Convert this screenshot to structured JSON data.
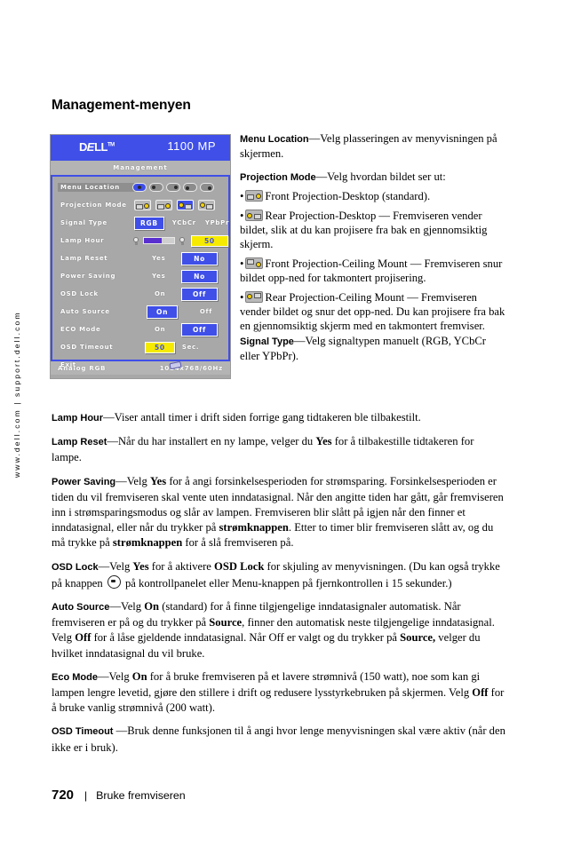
{
  "side_url": "www.dell.com | support.dell.com",
  "page_title": "Management-menyen",
  "osd": {
    "brand": "D",
    "brand_e": "E",
    "brand_rest": "LL",
    "tm": "TM",
    "model": "1100 MP",
    "tab_label": "Management",
    "rows": [
      {
        "label": "Menu Location",
        "type": "loc-icons",
        "selected_index": 0
      },
      {
        "label": "Projection Mode",
        "type": "pm-icons",
        "selected_index": 2
      },
      {
        "label": "Signal Type",
        "type": "options",
        "options": [
          "RGB",
          "YCbCr",
          "YPbPr"
        ],
        "selected_index": 0
      },
      {
        "label": "Lamp Hour",
        "type": "slider",
        "value": "50",
        "fill_percent": 60
      },
      {
        "label": "Lamp Reset",
        "type": "yesno",
        "left": "Yes",
        "right": "No",
        "selected": "right"
      },
      {
        "label": "Power Saving",
        "type": "yesno",
        "left": "Yes",
        "right": "No",
        "selected": "right"
      },
      {
        "label": "OSD Lock",
        "type": "onoff",
        "left": "On",
        "right": "Off",
        "selected": "right"
      },
      {
        "label": "Auto Source",
        "type": "onoff",
        "left": "On",
        "right": "Off",
        "selected": "left"
      },
      {
        "label": "ECO Mode",
        "type": "onoff",
        "left": "On",
        "right": "Off",
        "selected": "right"
      },
      {
        "label": "OSD Timeout",
        "type": "timeout",
        "value": "50",
        "unit": "Sec."
      },
      {
        "label": "Exit",
        "type": "exit"
      }
    ],
    "footer_left": "Analog RGB",
    "footer_right": "1024x768/60Hz"
  },
  "right_column": {
    "p1_term": "Menu Location",
    "p1_text": "—Velg plasseringen av menyvisningen på skjermen.",
    "p2_term": "Projection Mode",
    "p2_text": "—Velg hvordan bildet ser ut:",
    "b1_text": "Front Projection-Desktop (standard).",
    "b2_text": "Rear Projection-Desktop — Fremviseren vender bildet, slik at du kan projisere fra bak en gjennomsiktig skjerm.",
    "b3_text": "Front Projection-Ceiling Mount — Fremviseren snur bildet opp-ned for takmontert projisering.",
    "b4_text": "Rear Projection-Ceiling Mount — Fremviseren vender bildet og snur det opp-ned. Du kan projisere fra bak en gjennomsiktig skjerm med en takmontert fremviser.",
    "p3_term": "Signal Type",
    "p3_text": "—Velg signaltypen manuelt (RGB, YCbCr eller YPbPr)."
  },
  "flow_column": {
    "lamp_hour_term": "Lamp Hour",
    "lamp_hour_text": "—Viser antall timer i drift siden forrige gang tidtakeren ble tilbakestilt.",
    "lamp_reset_term": "Lamp Reset",
    "lamp_reset_a": "—Når du har installert en ny lampe, velger du ",
    "lamp_reset_b": "Yes",
    "lamp_reset_c": " for å tilbakestille tidtakeren for lampe.",
    "power_saving_term": "Power Saving",
    "ps_a": "—Velg ",
    "ps_b": "Yes",
    "ps_c": " for å angi forsinkelsesperioden for strømsparing. Forsinkelsesperioden er tiden du vil fremviseren skal vente uten inndatasignal. Når den angitte tiden har gått, går fremviseren inn i strømsparingsmodus og slår av lampen. Fremviseren blir slått på igjen når den finner et inndatasignal, eller når du trykker på ",
    "ps_d": "strømknappen",
    "ps_e": ". Etter to timer blir fremviseren slått av, og du må trykke på ",
    "ps_f": "strømknappen",
    "ps_g": " for å slå fremviseren på.",
    "osd_lock_term": "OSD Lock",
    "ol_a": "—Velg ",
    "ol_b": "Yes",
    "ol_c": " for å aktivere ",
    "ol_d": "OSD Lock",
    "ol_e": " for skjuling av menyvisningen. (Du kan også trykke på knappen ",
    "ol_f": " på kontrollpanelet eller Menu-knappen på fjernkontrollen i 15 sekunder.)",
    "auto_source_term": "Auto Source",
    "as_a": "—Velg ",
    "as_b": "On",
    "as_c": " (standard) for å finne tilgjengelige inndatasignaler automatisk. Når fremviseren er på og du trykker på ",
    "as_d": "Source",
    "as_e": ", finner den automatisk neste tilgjengelige inndatasignal. Velg ",
    "as_f": "Off",
    "as_g": " for å låse gjeldende inndatasignal. Når Off er valgt og du trykker på ",
    "as_h": "Source,",
    "as_i": " velger du hvilket inndatasignal du vil bruke.",
    "eco_mode_term": "Eco Mode",
    "em_a": "—Velg ",
    "em_b": "On",
    "em_c": " for å bruke fremviseren på et lavere strømnivå (150 watt), noe som kan gi lampen lengre levetid, gjøre den stillere i drift og redusere lysstyrkebruken på skjermen. Velg ",
    "em_d": "Off",
    "em_e": " for å bruke vanlig strømnivå (200 watt).",
    "osd_timeout_term": "OSD Timeout",
    "ot_text": " —Bruk denne funksjonen til å angi hvor lenge menyvisningen skal være aktiv (når den ikke er i bruk)."
  },
  "footer": {
    "page_number": "720",
    "separator": "|",
    "section": "Bruke fremviseren"
  },
  "colors": {
    "osd_blue": "#3f4fe8",
    "osd_gray": "#a8a8a8",
    "osd_yellow": "#f5ea00",
    "slider_fill": "#5a2fd0"
  }
}
